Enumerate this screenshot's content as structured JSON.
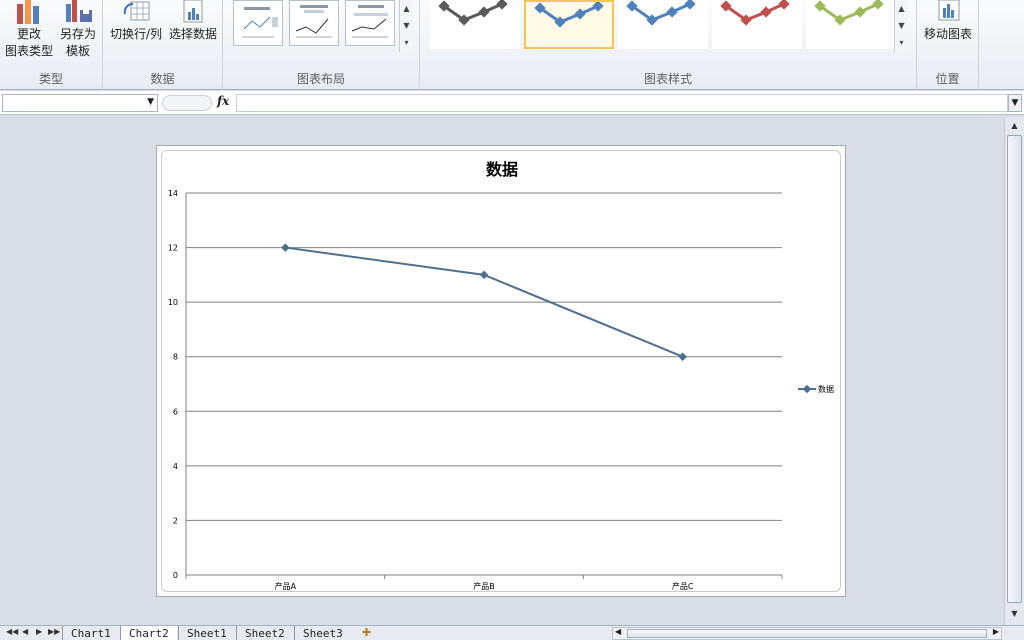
{
  "ribbon": {
    "groups": {
      "type": "类型",
      "data": "数据",
      "layout": "图表布局",
      "styles": "图表样式",
      "location": "位置"
    },
    "buttons": {
      "change_type_1": "更改",
      "change_type_2": "图表类型",
      "save_template_1": "另存为",
      "save_template_2": "模板",
      "switch_row_col": "切换行/列",
      "select_data": "选择数据",
      "move_chart": "移动图表"
    },
    "style_colors": [
      "#5a5a5a",
      "#4f81bd",
      "#4f81bd",
      "#c0504d",
      "#9bbb59"
    ]
  },
  "formula_bar": {
    "name_box": "",
    "fx": "fx",
    "formula": ""
  },
  "chart_data": {
    "type": "line",
    "title": "数据",
    "categories": [
      "产品A",
      "产品B",
      "产品C"
    ],
    "series": [
      {
        "name": "数据",
        "values": [
          12,
          11,
          8
        ],
        "color": "#4f6f8f"
      }
    ],
    "ylim": [
      0,
      14
    ],
    "yticks": [
      "0",
      "2",
      "4",
      "6",
      "8",
      "10",
      "12",
      "14"
    ],
    "grid": true,
    "legend": "right"
  },
  "tabs": {
    "nav": [
      "◀◀",
      "◀",
      "▶",
      "▶▶"
    ],
    "items": [
      "Chart1",
      "Chart2",
      "Sheet1",
      "Sheet2",
      "Sheet3"
    ],
    "active": "Chart2"
  }
}
